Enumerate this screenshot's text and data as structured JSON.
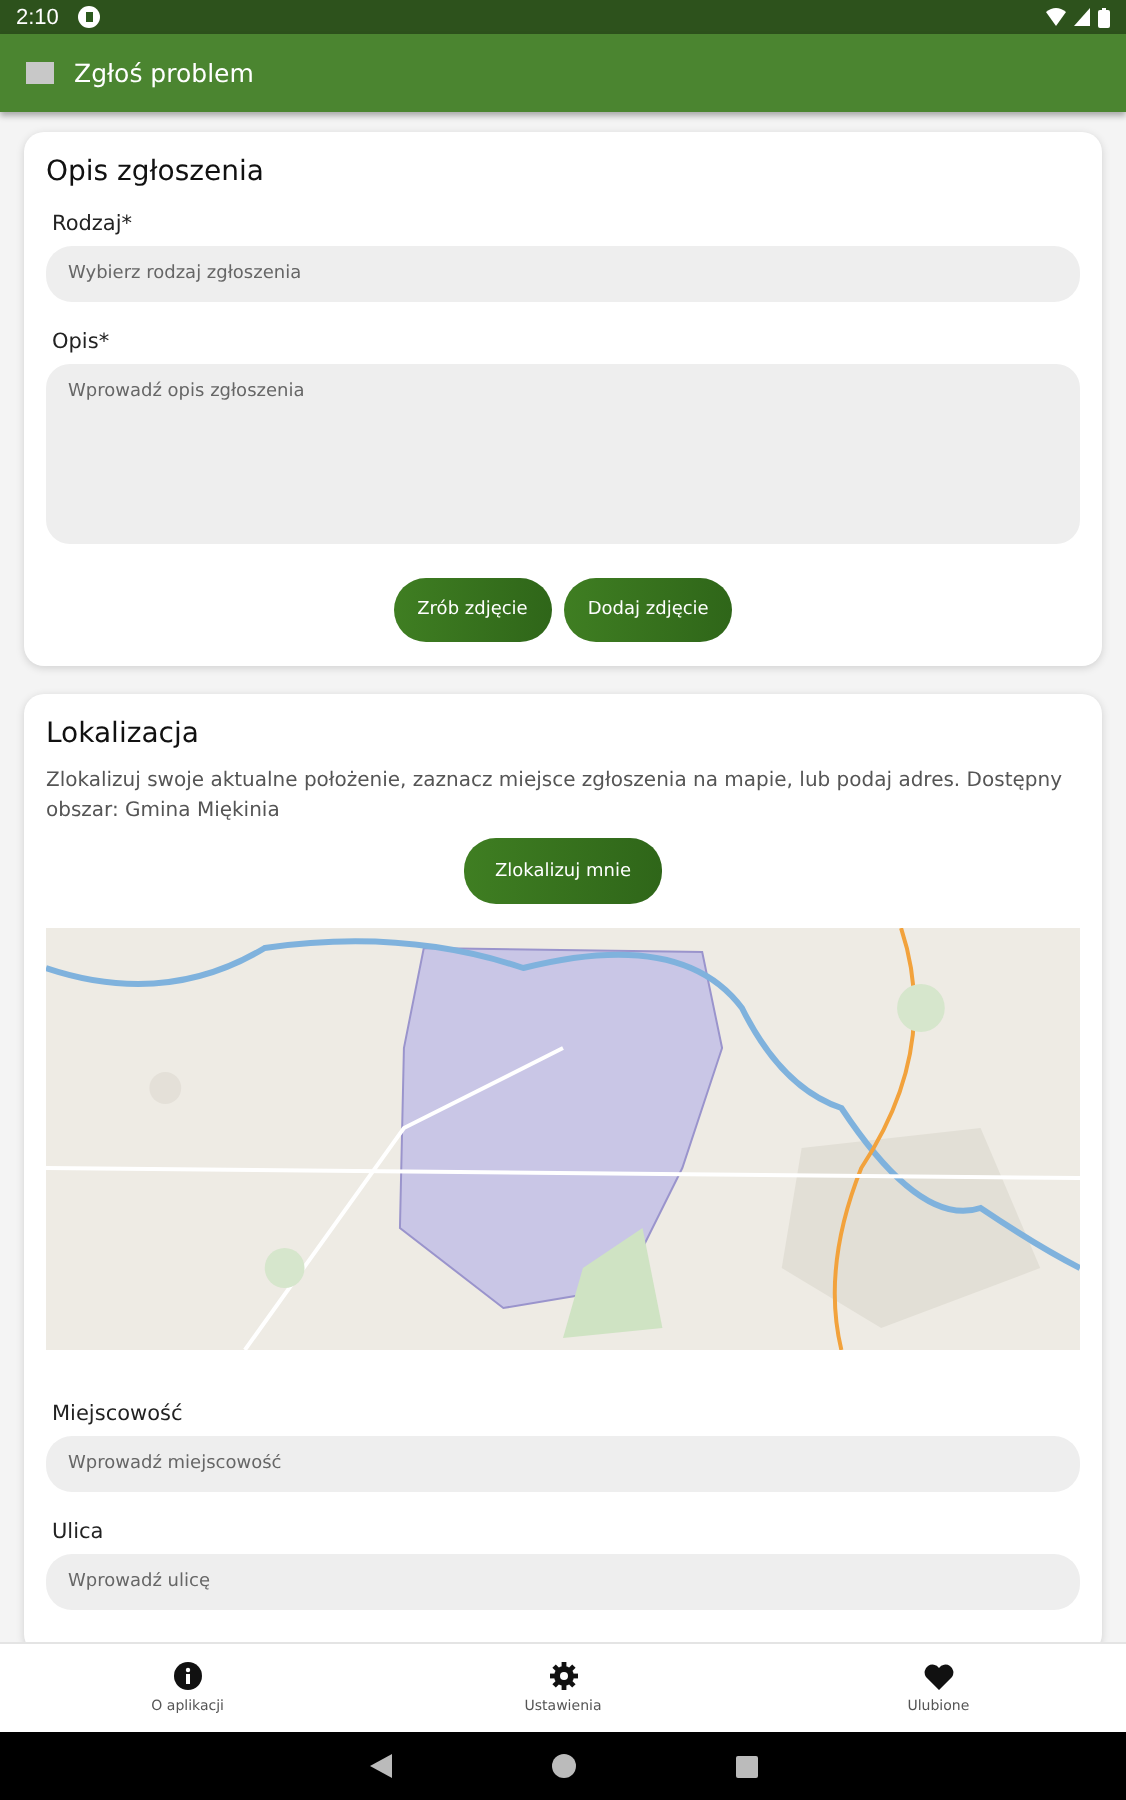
{
  "status_bar": {
    "time": "2:10"
  },
  "app_bar": {
    "title": "Zgłoś problem"
  },
  "description_card": {
    "title": "Opis zgłoszenia",
    "fields": [
      {
        "kind": "select",
        "label": "Rodzaj*",
        "placeholder": "Wybierz rodzaj zgłoszenia"
      },
      {
        "kind": "textarea",
        "label": "Opis*",
        "placeholder": "Wprowadź opis zgłoszenia"
      }
    ],
    "buttons": [
      "Zrób zdjęcie",
      "Dodaj zdjęcie"
    ]
  },
  "location_card": {
    "title": "Lokalizacja",
    "text": "Zlokalizuj swoje aktualne położenie, zaznacz miejsce zgłoszenia na mapie, lub podaj adres. Dostępny obszar: Gmina Miękinia",
    "button": "Zlokalizuj mnie",
    "fields": [
      {
        "kind": "input",
        "label": "Miejscowość",
        "placeholder": "Wprowadź miejscowość"
      },
      {
        "kind": "input",
        "label": "Ulica",
        "placeholder": "Wprowadź ulicę"
      }
    ]
  },
  "bottom_nav": [
    {
      "kind": "about",
      "label": "O aplikacji"
    },
    {
      "kind": "settings",
      "label": "Ustawienia"
    },
    {
      "kind": "favorites",
      "label": "Ulubione"
    }
  ]
}
